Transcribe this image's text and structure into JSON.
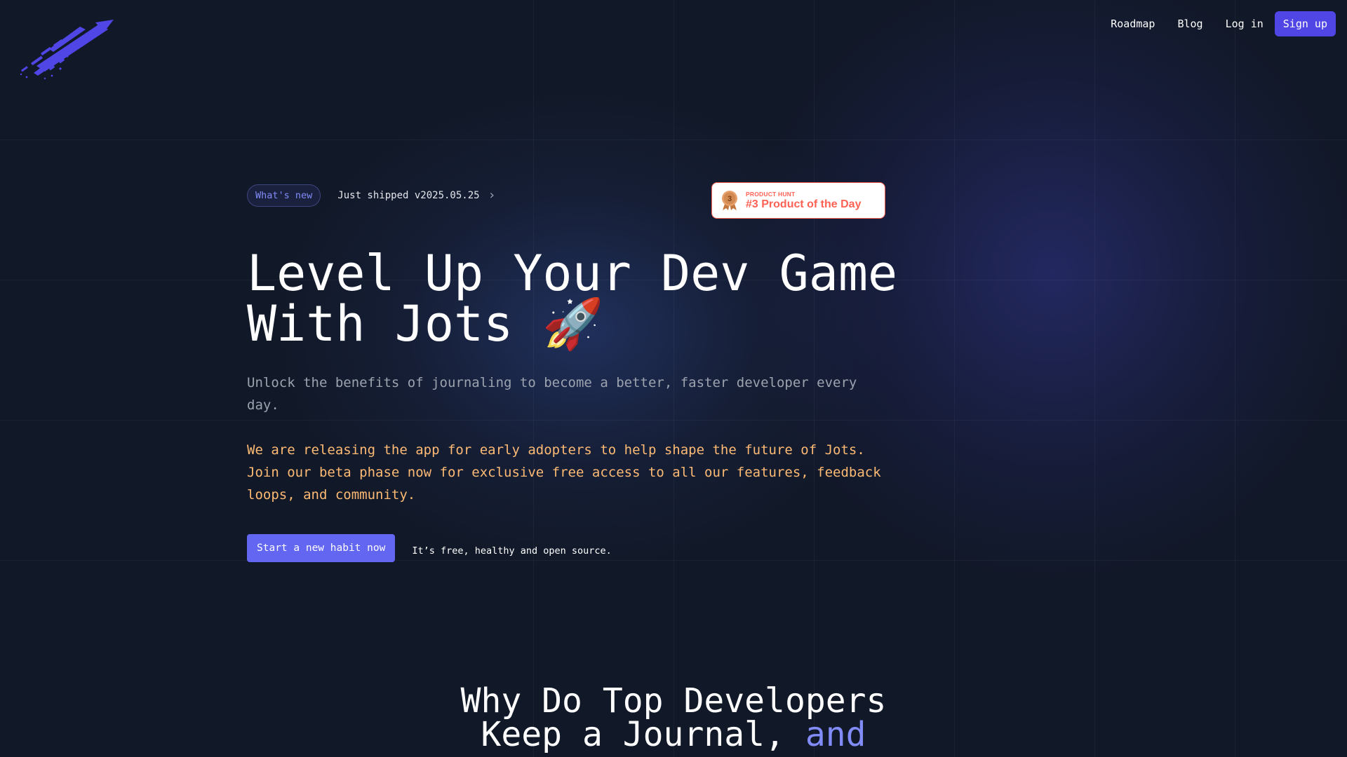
{
  "nav": {
    "roadmap": "Roadmap",
    "blog": "Blog",
    "login": "Log in",
    "signup": "Sign up"
  },
  "announcement": {
    "badge": "What's new",
    "text": "Just shipped v2025.05.25"
  },
  "product_hunt": {
    "rank": "3",
    "label": "PRODUCT HUNT",
    "title": "#3 Product of the Day"
  },
  "hero": {
    "title_line1": "Level Up Your Dev Game",
    "title_line2": "With Jots 🚀",
    "subtitle": "Unlock the benefits of journaling to become a better, faster developer every day.",
    "beta_text": "We are releasing the app for early adopters to help shape the future of Jots. Join our beta phase now for exclusive free access to all our features, feedback loops, and community.",
    "cta_label": "Start a new habit now",
    "cta_note": "It’s free, healthy and open source."
  },
  "section": {
    "title_line1": "Why Do Top Developers",
    "title_line2_prefix": "Keep a Journal, ",
    "title_line2_accent": "and"
  },
  "colors": {
    "background": "#111827",
    "brand": "#4f46e5",
    "cta": "#6366f1",
    "accent_text": "#818cf8",
    "beta_text": "#fdba74",
    "product_hunt": "#ff6154"
  },
  "icons": {
    "logo": "rocket-streak-logo",
    "chevron": "chevron-right-icon",
    "medal": "bronze-medal-icon"
  }
}
